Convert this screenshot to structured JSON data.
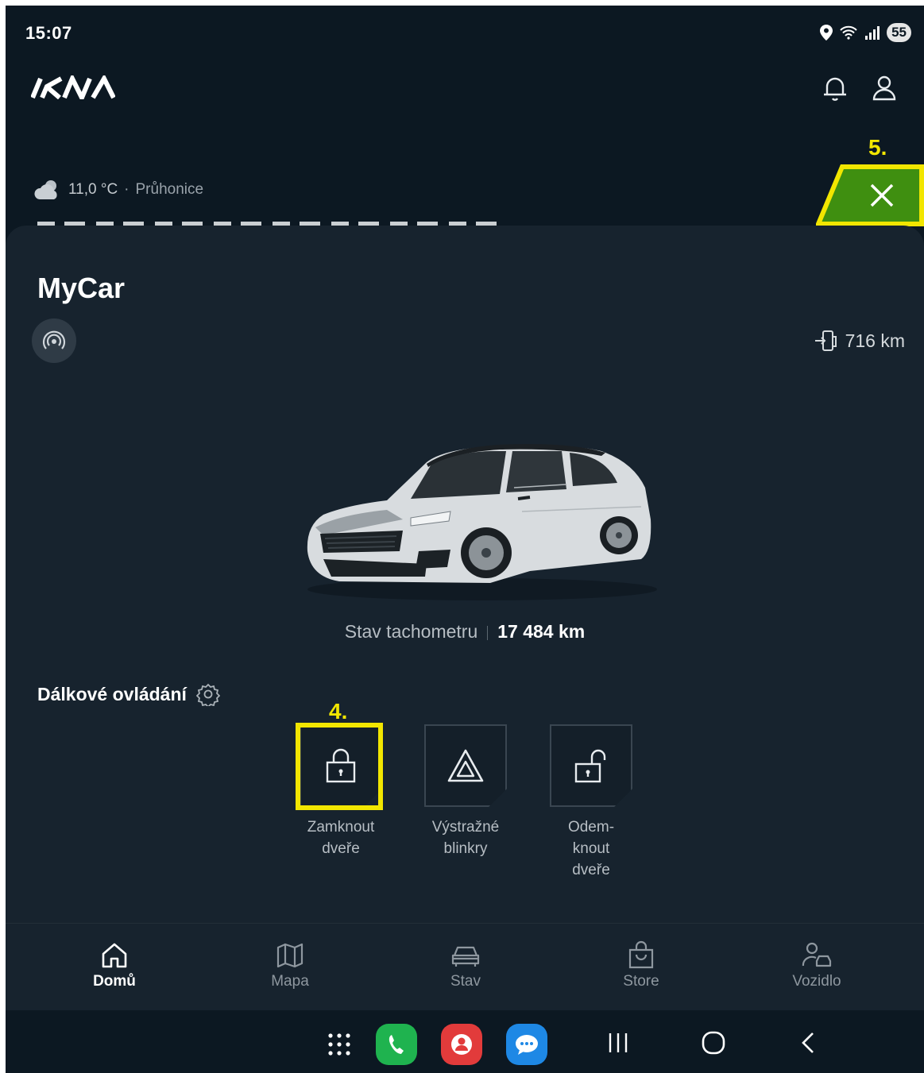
{
  "status_bar": {
    "time": "15:07",
    "battery": "55"
  },
  "header": {
    "logo": "KIA",
    "icons": [
      "bell-icon",
      "user-icon"
    ]
  },
  "weather": {
    "temperature": "11,0 °C",
    "separator": "·",
    "location": "Průhonice"
  },
  "annotations": {
    "step5": "5.",
    "step4": "4.",
    "highlight_color": "#f2e600"
  },
  "colors": {
    "accent_green": "#3f8f10",
    "background": "#0c1822",
    "sheet": "#17232e"
  },
  "mycar": {
    "title": "MyCar",
    "range": "716 km",
    "odometer_label": "Stav tachometru",
    "odometer_value": "17 484 km"
  },
  "remote": {
    "title": "Dálkové ovládání",
    "controls": [
      {
        "label_line1": "Zamknout",
        "label_line2": "dveře",
        "icon": "lock-icon"
      },
      {
        "label_line1": "Výstražné",
        "label_line2": "blinkry",
        "icon": "hazard-icon"
      },
      {
        "label_line1": "Odem-",
        "label_line2": "knout",
        "label_line3": "dveře",
        "icon": "unlock-icon"
      }
    ]
  },
  "tabs": [
    {
      "label": "Domů",
      "icon": "home-icon",
      "active": true
    },
    {
      "label": "Mapa",
      "icon": "map-icon"
    },
    {
      "label": "Stav",
      "icon": "car-icon"
    },
    {
      "label": "Store",
      "icon": "store-bag-icon"
    },
    {
      "label": "Vozidlo",
      "icon": "vehicle-user-icon"
    }
  ]
}
